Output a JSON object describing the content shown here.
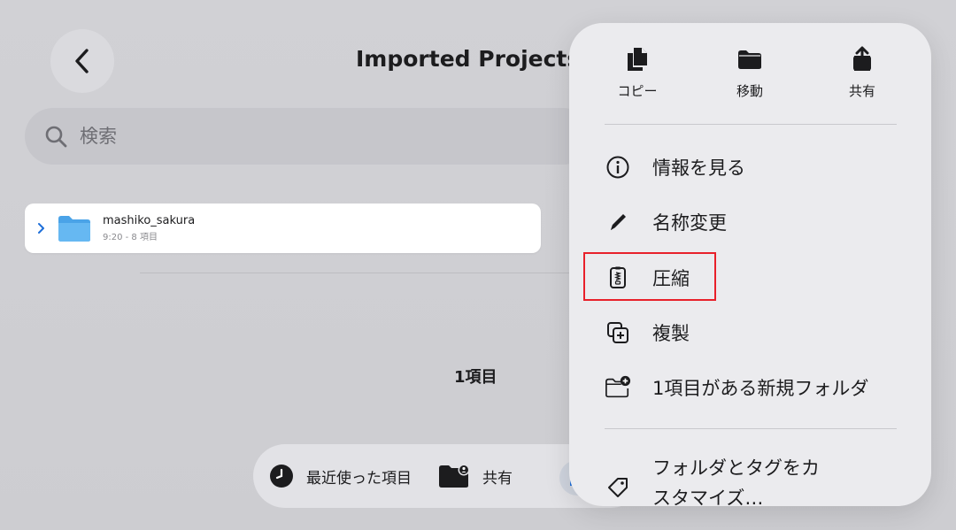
{
  "header": {
    "back_label": "",
    "title": "Imported Projects"
  },
  "search": {
    "placeholder": "検索",
    "value": ""
  },
  "folder": {
    "name": "mashiko_sakura",
    "subtitle": "9:20 - 8 項目",
    "color": "#5ab0ee"
  },
  "footer": {
    "item_count": "1項目"
  },
  "tabbar": {
    "recent_label": "最近使った項目",
    "shared_label": "共有"
  },
  "menu": {
    "quick_actions": [
      {
        "label": "コピー",
        "icon": "doc-copy-icon"
      },
      {
        "label": "移動",
        "icon": "folder-icon"
      },
      {
        "label": "共有",
        "icon": "share-icon"
      }
    ],
    "items": [
      {
        "label": "情報を見る",
        "icon": "info-icon"
      },
      {
        "label": "名称変更",
        "icon": "pencil-icon"
      },
      {
        "label": "圧縮",
        "icon": "zip-archive-icon"
      },
      {
        "label": "複製",
        "icon": "duplicate-icon"
      },
      {
        "label": "1項目がある新規フォルダ",
        "icon": "new-folder-icon"
      },
      {
        "label": "フォルダとタグをカスタマイズ…",
        "icon": "tag-icon"
      }
    ]
  },
  "colors": {
    "accent": "#1e6fd9",
    "highlight": "#e8202a"
  }
}
